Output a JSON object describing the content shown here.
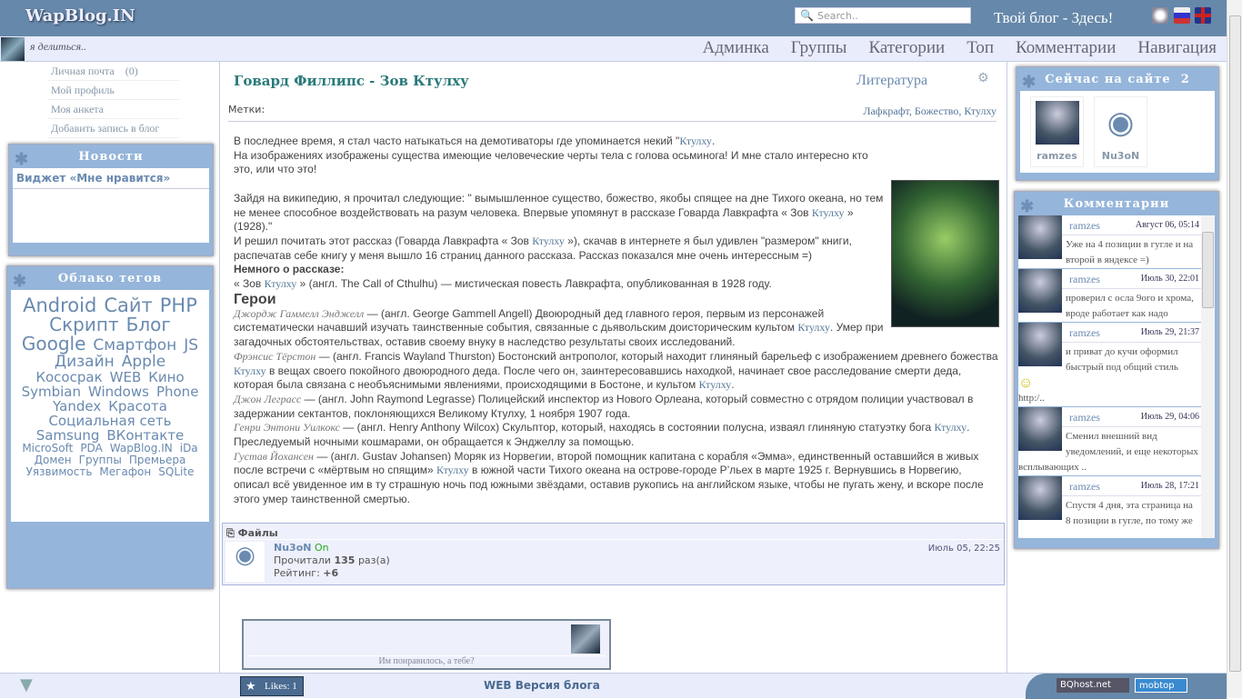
{
  "header": {
    "logo": "WapBlog.IN",
    "search_placeholder": "Search..",
    "slogan": "Твой блог - Здесь!"
  },
  "nav": {
    "status": "я делиться..",
    "menu": [
      "Админка",
      "Группы",
      "Категории",
      "Топ",
      "Комментарии",
      "Навигация"
    ]
  },
  "user_links": [
    {
      "label": "Личная почта",
      "count": "(0)"
    },
    {
      "label": "Мой профиль"
    },
    {
      "label": "Моя анкета"
    },
    {
      "label": "Добавить запись в блог"
    }
  ],
  "news": {
    "title": "Новости",
    "items": [
      "Виджет «Мне нравится»"
    ]
  },
  "tag_cloud": {
    "title": "Облако тегов",
    "tags": [
      {
        "t": "Android",
        "s": 21
      },
      {
        "t": "Сайт",
        "s": 21
      },
      {
        "t": "PHP",
        "s": 21
      },
      {
        "t": "Скрипт",
        "s": 20
      },
      {
        "t": "Блог",
        "s": 20
      },
      {
        "t": "Google",
        "s": 20
      },
      {
        "t": "Смартфон",
        "s": 17
      },
      {
        "t": "JS",
        "s": 17
      },
      {
        "t": "Дизайн",
        "s": 17
      },
      {
        "t": "Apple",
        "s": 17
      },
      {
        "t": "Кососрак",
        "s": 15
      },
      {
        "t": "WEB",
        "s": 15
      },
      {
        "t": "Кино",
        "s": 15
      },
      {
        "t": "Symbian",
        "s": 15
      },
      {
        "t": "Windows",
        "s": 15
      },
      {
        "t": "Phone",
        "s": 15
      },
      {
        "t": "Yandex",
        "s": 15
      },
      {
        "t": "Красота",
        "s": 15
      },
      {
        "t": "Социальная сеть",
        "s": 15
      },
      {
        "t": "Samsung",
        "s": 15
      },
      {
        "t": "ВКонтакте",
        "s": 15
      },
      {
        "t": "MicroSoft",
        "s": 12
      },
      {
        "t": "PDA",
        "s": 12
      },
      {
        "t": "WapBlog.IN",
        "s": 12
      },
      {
        "t": "iDa",
        "s": 12
      },
      {
        "t": "Домен",
        "s": 12
      },
      {
        "t": "Группы",
        "s": 12
      },
      {
        "t": "Премьера",
        "s": 12
      },
      {
        "t": "Уязвимость",
        "s": 12
      },
      {
        "t": "Мегафон",
        "s": 12
      },
      {
        "t": "SQLite",
        "s": 12
      }
    ]
  },
  "post": {
    "title": "Говард Филлипс - Зов Ктулху",
    "category": "Литература",
    "tags_label": "Метки:",
    "tags": "Лафкрафт, Божество, Ктулху",
    "body": [
      [
        [
          "",
          "В последнее время, я стал часто натыкаться на демотиваторы где упоминается некий \""
        ],
        [
          "k",
          "Ктулху"
        ],
        [
          "",
          "."
        ]
      ],
      [
        [
          "",
          "На изображениях изображены существа имеющие человеческие черты тела с голова осьминога! И мне стало интересно кто это, или что это!"
        ]
      ],
      [
        [
          "",
          " "
        ]
      ],
      [
        [
          "",
          "Зайдя на википедию, я прочитал следующие: \" вымышленное существо, божество, якобы спящее на дне Тихого океана, но тем не менее способное воздействовать на разум человека. Впервые упомянут в рассказе Говарда Лавкрафта « Зов "
        ],
        [
          "k",
          "Ктулху"
        ],
        [
          "",
          " » (1928).\""
        ]
      ],
      [
        [
          "",
          "И решил почитать этот рассказ (Говарда Лавкрафта « Зов "
        ],
        [
          "k",
          "Ктулху"
        ],
        [
          "",
          " »), скачав в интернете я был удивлен \"размером\" книги, распечатав себе книгу у меня вышло 16 страниц данного рассказа. Рассказ показался мне очень интерессным =)"
        ]
      ],
      [
        [
          "b",
          "Немного о рассказе:"
        ]
      ],
      [
        [
          "",
          "« Зов "
        ],
        [
          "k",
          "Ктулху"
        ],
        [
          "",
          " » (англ. The Call of Cthulhu) — мистическая повесть Лавкрафта, опубликованная в 1928 году."
        ]
      ],
      [
        [
          "h",
          "Герои"
        ]
      ],
      [
        [
          "n",
          "Джордж Гаммелл Энджелл"
        ],
        [
          "",
          " — (англ. George Gammell Angell) Двоюродный дед главного героя, первым из персонажей систематически начавший изучать таинственные события, связанные с дьявольским доисторическим культом "
        ],
        [
          "k",
          "Ктулху"
        ],
        [
          "",
          ". Умер при загадочных обстоятельствах, оставив своему внуку в наследство результаты своих исследований."
        ]
      ],
      [
        [
          "n",
          "Фрэнсис Тёрстон"
        ],
        [
          "",
          " — (англ. Francis Wayland Thurston) Бостонский антрополог, который находит глиняный барельеф с изображением древнего божества "
        ],
        [
          "k",
          "Ктулху"
        ],
        [
          "",
          " в вещах своего покойного двоюродного деда. После чего он, заинтересовавшись находкой, начинает свое расследование смерти деда, которая была связана с необъяснимыми явлениями, происходящими в Бостоне, и культом "
        ],
        [
          "k",
          "Ктулху"
        ],
        [
          "",
          "."
        ]
      ],
      [
        [
          "n",
          "Джон Леграсс"
        ],
        [
          "",
          " — (англ. John Raymond Legrasse) Полицейский инспектор из Нового Орлеана, который совместно с отрядом полиции участвовал в задержании сектантов, поклоняющихся Великому Ктулху, 1 ноября 1907 года."
        ]
      ],
      [
        [
          "n",
          "Генри Энтони Уилкокс"
        ],
        [
          "",
          " — (англ. Henry Anthony Wilcox) Скульптор, который, находясь в состоянии полусна, изваял глиняную статуэтку бога "
        ],
        [
          "k",
          "Ктулху"
        ],
        [
          "",
          ". Преследуемый ночными кошмарами, он обращается к Энджеллу за помощью."
        ]
      ],
      [
        [
          "n",
          "Густав Йохансен"
        ],
        [
          "",
          " — (англ. Gustav Johansen) Моряк из Норвегии, второй помощник капитана с корабля «Эмма», единственный оставшийся в живых после встречи с «мёртвым но спящим» "
        ],
        [
          "k",
          "Ктулху"
        ],
        [
          "",
          " в южной части Тихого океана на острове-городе Р’льех в марте 1925 г. Вернувшись в Норвегию, описал всё увиденное им в ту страшную ночь под южными звёздами, оставив рукопись на английском языке, чтобы не пугать жену, и вскоре после этого умер таинственной смертью."
        ]
      ]
    ]
  },
  "files": {
    "label": "Файлы",
    "author": "Nu3oN",
    "online": "On",
    "read_prefix": "Прочитали",
    "read_count": "135",
    "read_suffix": "раз(а)",
    "rating_label": "Рейтинг:",
    "rating": "+6",
    "date": "Июль 05, 22:25"
  },
  "like_widget": {
    "text": "Им понравилось, а тебе?"
  },
  "online": {
    "title": "Сейчас на сайте",
    "count": "2",
    "users": [
      "ramzes",
      "Nu3oN"
    ]
  },
  "comments": {
    "title": "Комментарии",
    "items": [
      {
        "user": "ramzes",
        "date": "Август 06, 05:14",
        "text": "Уже на 4 позиции в гугле и на второй в яндексе =)"
      },
      {
        "user": "ramzes",
        "date": "Июль 30, 22:01",
        "text": "проверил с осла 9ого и хрома, вроде работает как надо"
      },
      {
        "user": "ramzes",
        "date": "Июль 29, 21:37",
        "text": "и приват до кучи оформил быстрый под общий стиль",
        "extra": "http:/.."
      },
      {
        "user": "ramzes",
        "date": "Июль 29, 04:06",
        "text": "Сменил внешний вид уведомлений, и еще некоторых всплывающих .."
      },
      {
        "user": "ramzes",
        "date": "Июль 28, 17:21",
        "text": "Спустя 4 дня, эта страница на 8 позиции в гугле, по тому же .."
      }
    ]
  },
  "footer": {
    "likes": "Likes: 1",
    "web_version": "WEB Версия блога",
    "badges": [
      "BQhost.net",
      "mobtop"
    ]
  },
  "colors": {
    "header": "#6688aa",
    "box": "#95b5da",
    "link": "#557799",
    "title": "#2a7a7a"
  }
}
